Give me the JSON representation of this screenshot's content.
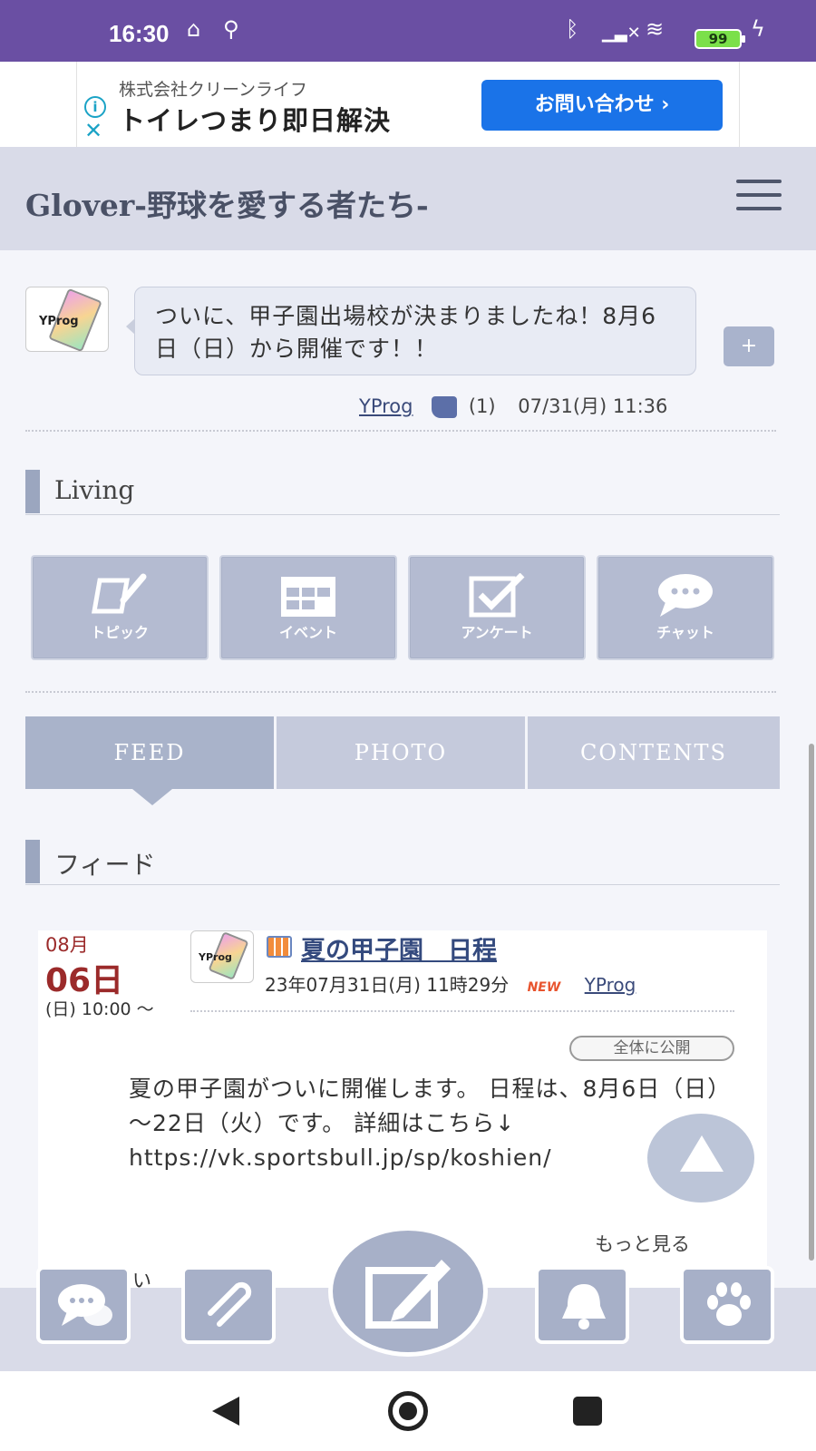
{
  "status_bar": {
    "time": "16:30",
    "battery": "99"
  },
  "ad": {
    "company": "株式会社クリーンライフ",
    "headline": "トイレつまり即日解決",
    "cta": "お問い合わせ ›",
    "info_icon": "info-icon",
    "close_icon": "close-icon"
  },
  "header": {
    "title": "Glover-野球を愛する者たち-",
    "menu_icon": "hamburger-icon"
  },
  "tweet": {
    "avatar_text": "YProg",
    "text": "ついに、甲子園出場校が決まりましたね！8月6日（日）から開催です！！",
    "plus": "+",
    "user": "YProg",
    "likes": "(1)",
    "datetime": "07/31(月) 11:36"
  },
  "living": {
    "heading": "Living",
    "buttons": [
      {
        "label": "トピック",
        "icon": "topic-icon"
      },
      {
        "label": "イベント",
        "icon": "calendar-icon"
      },
      {
        "label": "アンケート",
        "icon": "survey-check-icon"
      },
      {
        "label": "チャット",
        "icon": "chat-icon"
      }
    ]
  },
  "tabs": [
    {
      "label": "FEED",
      "active": true
    },
    {
      "label": "PHOTO",
      "active": false
    },
    {
      "label": "CONTENTS",
      "active": false
    }
  ],
  "feed": {
    "heading": "フィード",
    "card": {
      "month": "08月",
      "day": "06日",
      "time": "(日) 10:00 ～",
      "avatar_text": "YProg",
      "title": "夏の甲子園　日程",
      "posted": "23年07月31日(月) 11時29分",
      "new_badge": "NEW",
      "user": "YProg",
      "visibility": "全体に公開",
      "body": "夏の甲子園がついに開催します。 日程は、8月6日（日）～22日（火）です。 詳細はこちら↓ https://vk.sportsbull.jp/sp/koshien/",
      "more": "もっと見る",
      "like_row": "い　　　い ー"
    }
  },
  "toolbar": {
    "buttons": [
      "chat-bubbles-icon",
      "paperclip-icon",
      "compose-pen-icon",
      "bell-icon",
      "paw-icon"
    ]
  },
  "colors": {
    "status_bar": "#6a4fa3",
    "accent": "#a9b3ca",
    "ad_cta": "#1a73e8",
    "date": "#9b2a2a"
  }
}
